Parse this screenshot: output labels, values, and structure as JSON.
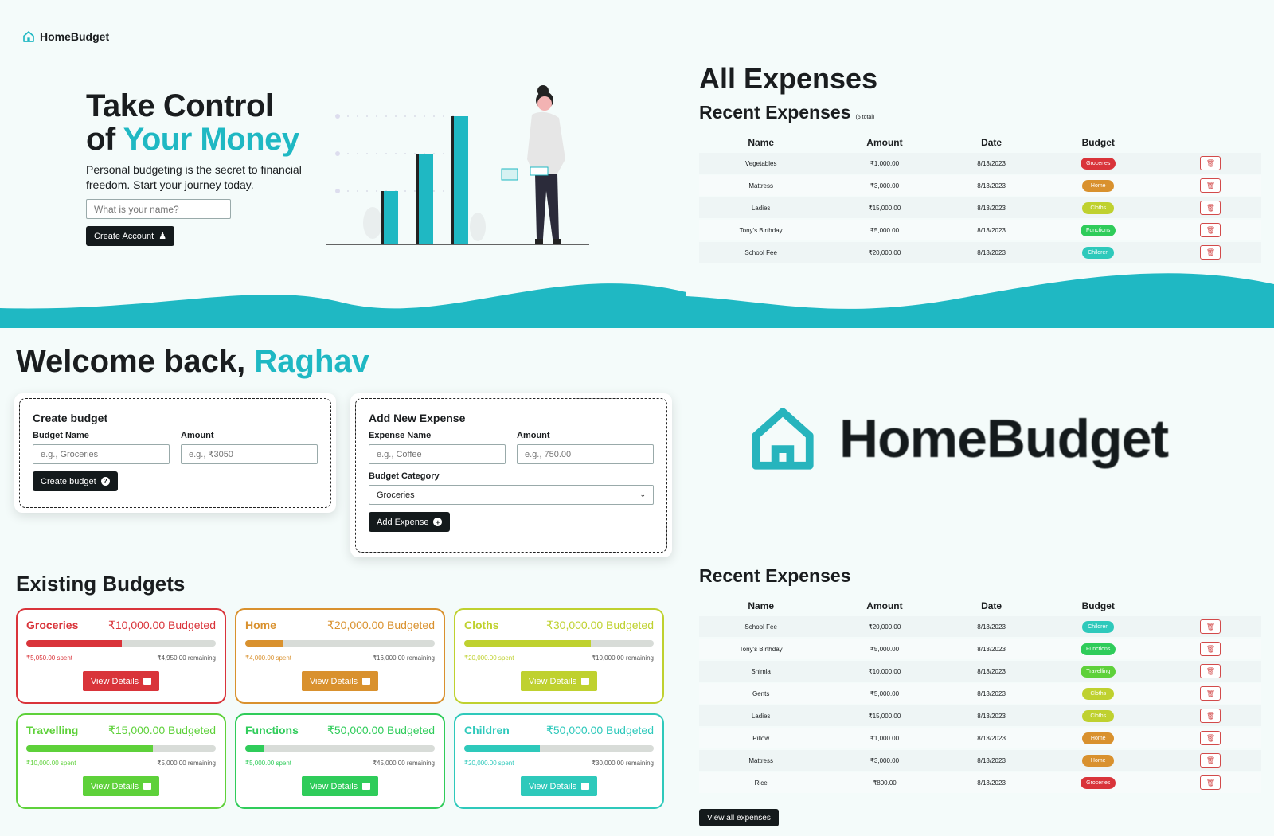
{
  "brand": {
    "name": "HomeBudget"
  },
  "hero": {
    "title_line1": "Take Control",
    "title_of": "of",
    "title_accent": "Your Money",
    "subtitle": "Personal budgeting is the secret to financial freedom. Start your journey today.",
    "name_placeholder": "What is your name?",
    "create_account_label": "Create Account"
  },
  "all_expenses": {
    "title": "All Expenses",
    "recent_title": "Recent Expenses",
    "total_note": "(5 total)",
    "columns": [
      "Name",
      "Amount",
      "Date",
      "Budget"
    ],
    "rows": [
      {
        "name": "Vegetables",
        "amount": "₹1,000.00",
        "date": "8/13/2023",
        "budget": "Groceries",
        "color": "#d9343a"
      },
      {
        "name": "Mattress",
        "amount": "₹3,000.00",
        "date": "8/13/2023",
        "budget": "Home",
        "color": "#d9912e"
      },
      {
        "name": "Ladies",
        "amount": "₹15,000.00",
        "date": "8/13/2023",
        "budget": "Cloths",
        "color": "#bfd12f"
      },
      {
        "name": "Tony's Birthday",
        "amount": "₹5,000.00",
        "date": "8/13/2023",
        "budget": "Functions",
        "color": "#2fcc5a"
      },
      {
        "name": "School Fee",
        "amount": "₹20,000.00",
        "date": "8/13/2023",
        "budget": "Children",
        "color": "#2ec9bb"
      }
    ]
  },
  "dashboard": {
    "welcome": "Welcome back,",
    "user": "Raghav",
    "create_budget": {
      "title": "Create budget",
      "name_label": "Budget Name",
      "name_placeholder": "e.g., Groceries",
      "amount_label": "Amount",
      "amount_placeholder": "e.g., ₹3050",
      "button": "Create budget"
    },
    "add_expense": {
      "title": "Add New Expense",
      "name_label": "Expense Name",
      "name_placeholder": "e.g., Coffee",
      "amount_label": "Amount",
      "amount_placeholder": "e.g., 750.00",
      "category_label": "Budget Category",
      "category_value": "Groceries",
      "button": "Add Expense"
    },
    "existing_title": "Existing Budgets",
    "budgets": [
      {
        "name": "Groceries",
        "budgeted": "₹10,000.00 Budgeted",
        "spent": "₹5,050.00 spent",
        "remaining": "₹4,950.00 remaining",
        "progress": 0.505,
        "color": "#d9343a",
        "button": "View Details"
      },
      {
        "name": "Home",
        "budgeted": "₹20,000.00 Budgeted",
        "spent": "₹4,000.00 spent",
        "remaining": "₹16,000.00 remaining",
        "progress": 0.2,
        "color": "#d9912e",
        "button": "View Details"
      },
      {
        "name": "Cloths",
        "budgeted": "₹30,000.00 Budgeted",
        "spent": "₹20,000.00 spent",
        "remaining": "₹10,000.00 remaining",
        "progress": 0.667,
        "color": "#bfd12f",
        "button": "View Details"
      },
      {
        "name": "Travelling",
        "budgeted": "₹15,000.00 Budgeted",
        "spent": "₹10,000.00 spent",
        "remaining": "₹5,000.00 remaining",
        "progress": 0.667,
        "color": "#5ed13a",
        "button": "View Details"
      },
      {
        "name": "Functions",
        "budgeted": "₹50,000.00 Budgeted",
        "spent": "₹5,000.00 spent",
        "remaining": "₹45,000.00 remaining",
        "progress": 0.1,
        "color": "#2fcc5a",
        "button": "View Details"
      },
      {
        "name": "Children",
        "budgeted": "₹50,000.00 Budgeted",
        "spent": "₹20,000.00 spent",
        "remaining": "₹30,000.00 remaining",
        "progress": 0.4,
        "color": "#2ec9bb",
        "button": "View Details"
      }
    ]
  },
  "recent2": {
    "title": "Recent Expenses",
    "columns": [
      "Name",
      "Amount",
      "Date",
      "Budget"
    ],
    "rows": [
      {
        "name": "School Fee",
        "amount": "₹20,000.00",
        "date": "8/13/2023",
        "budget": "Children",
        "color": "#2ec9bb"
      },
      {
        "name": "Tony's Birthday",
        "amount": "₹5,000.00",
        "date": "8/13/2023",
        "budget": "Functions",
        "color": "#2fcc5a"
      },
      {
        "name": "Shimla",
        "amount": "₹10,000.00",
        "date": "8/13/2023",
        "budget": "Travelling",
        "color": "#5ed13a"
      },
      {
        "name": "Gents",
        "amount": "₹5,000.00",
        "date": "8/13/2023",
        "budget": "Cloths",
        "color": "#bfd12f"
      },
      {
        "name": "Ladies",
        "amount": "₹15,000.00",
        "date": "8/13/2023",
        "budget": "Cloths",
        "color": "#bfd12f"
      },
      {
        "name": "Pillow",
        "amount": "₹1,000.00",
        "date": "8/13/2023",
        "budget": "Home",
        "color": "#d9912e"
      },
      {
        "name": "Mattress",
        "amount": "₹3,000.00",
        "date": "8/13/2023",
        "budget": "Home",
        "color": "#d9912e"
      },
      {
        "name": "Rice",
        "amount": "₹800.00",
        "date": "8/13/2023",
        "budget": "Groceries",
        "color": "#d9343a"
      }
    ],
    "view_all": "View all expenses"
  },
  "colors": {
    "accent": "#1fb8c3",
    "dark": "#141a1c",
    "danger": "#d24a4a"
  }
}
